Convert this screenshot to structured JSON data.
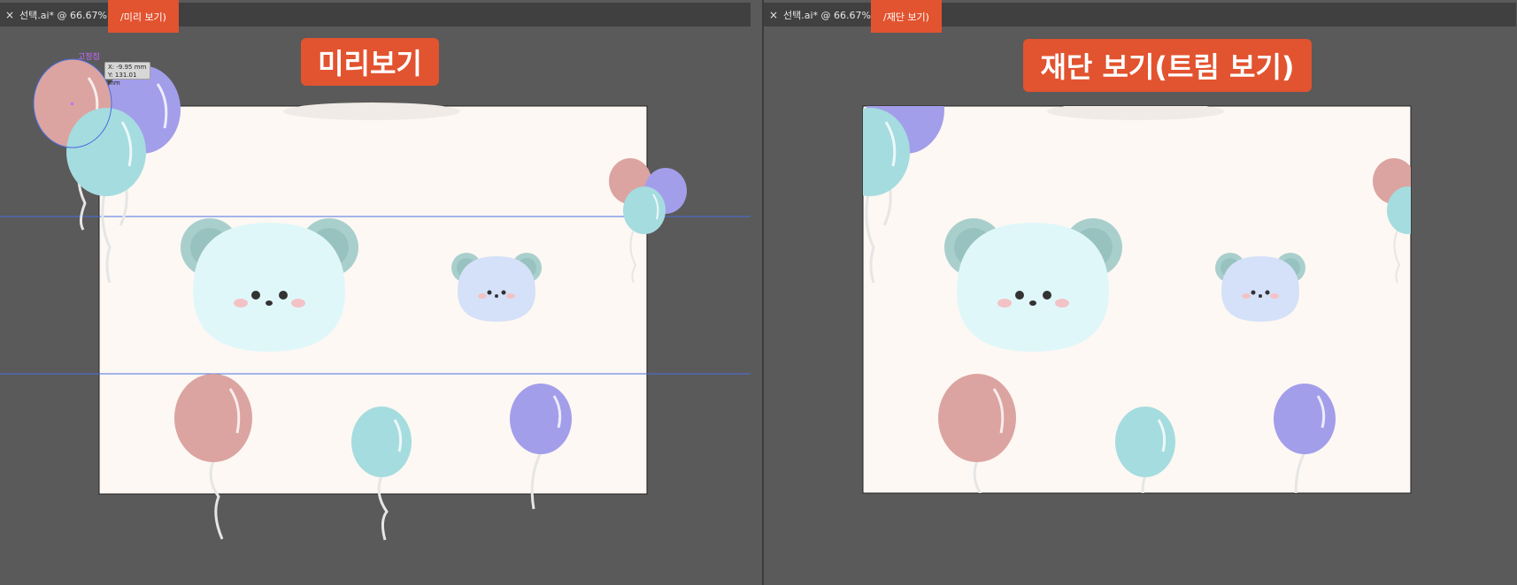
{
  "left_window": {
    "close_glyph": "×",
    "tab_title": "선택.ai* @ 66.67%(R",
    "view_mode": "/미리 보기)",
    "banner": "미리보기",
    "anchor_label": "고정점",
    "tooltip": {
      "x": "X: -9.95 mm",
      "y": "Y: 131.01 mm"
    }
  },
  "right_window": {
    "close_glyph": "×",
    "tab_title": "선택.ai* @ 66.67%(R",
    "view_mode": "/재단 보기)",
    "banner": "재단 보기(트림 보기)"
  },
  "colors": {
    "accent": "#e2532f",
    "canvas_bg": "#5a5a5a",
    "artboard": "#fdf8f3",
    "balloon_pink": "#dba4a1",
    "balloon_purple": "#a39eea",
    "balloon_teal": "#a5dcdf",
    "bear_face": "#e0f7fa",
    "bear_ear": "#a9cfcd",
    "mouse_face": "#d5e1f8",
    "guide_blue": "#4a6fe0"
  }
}
